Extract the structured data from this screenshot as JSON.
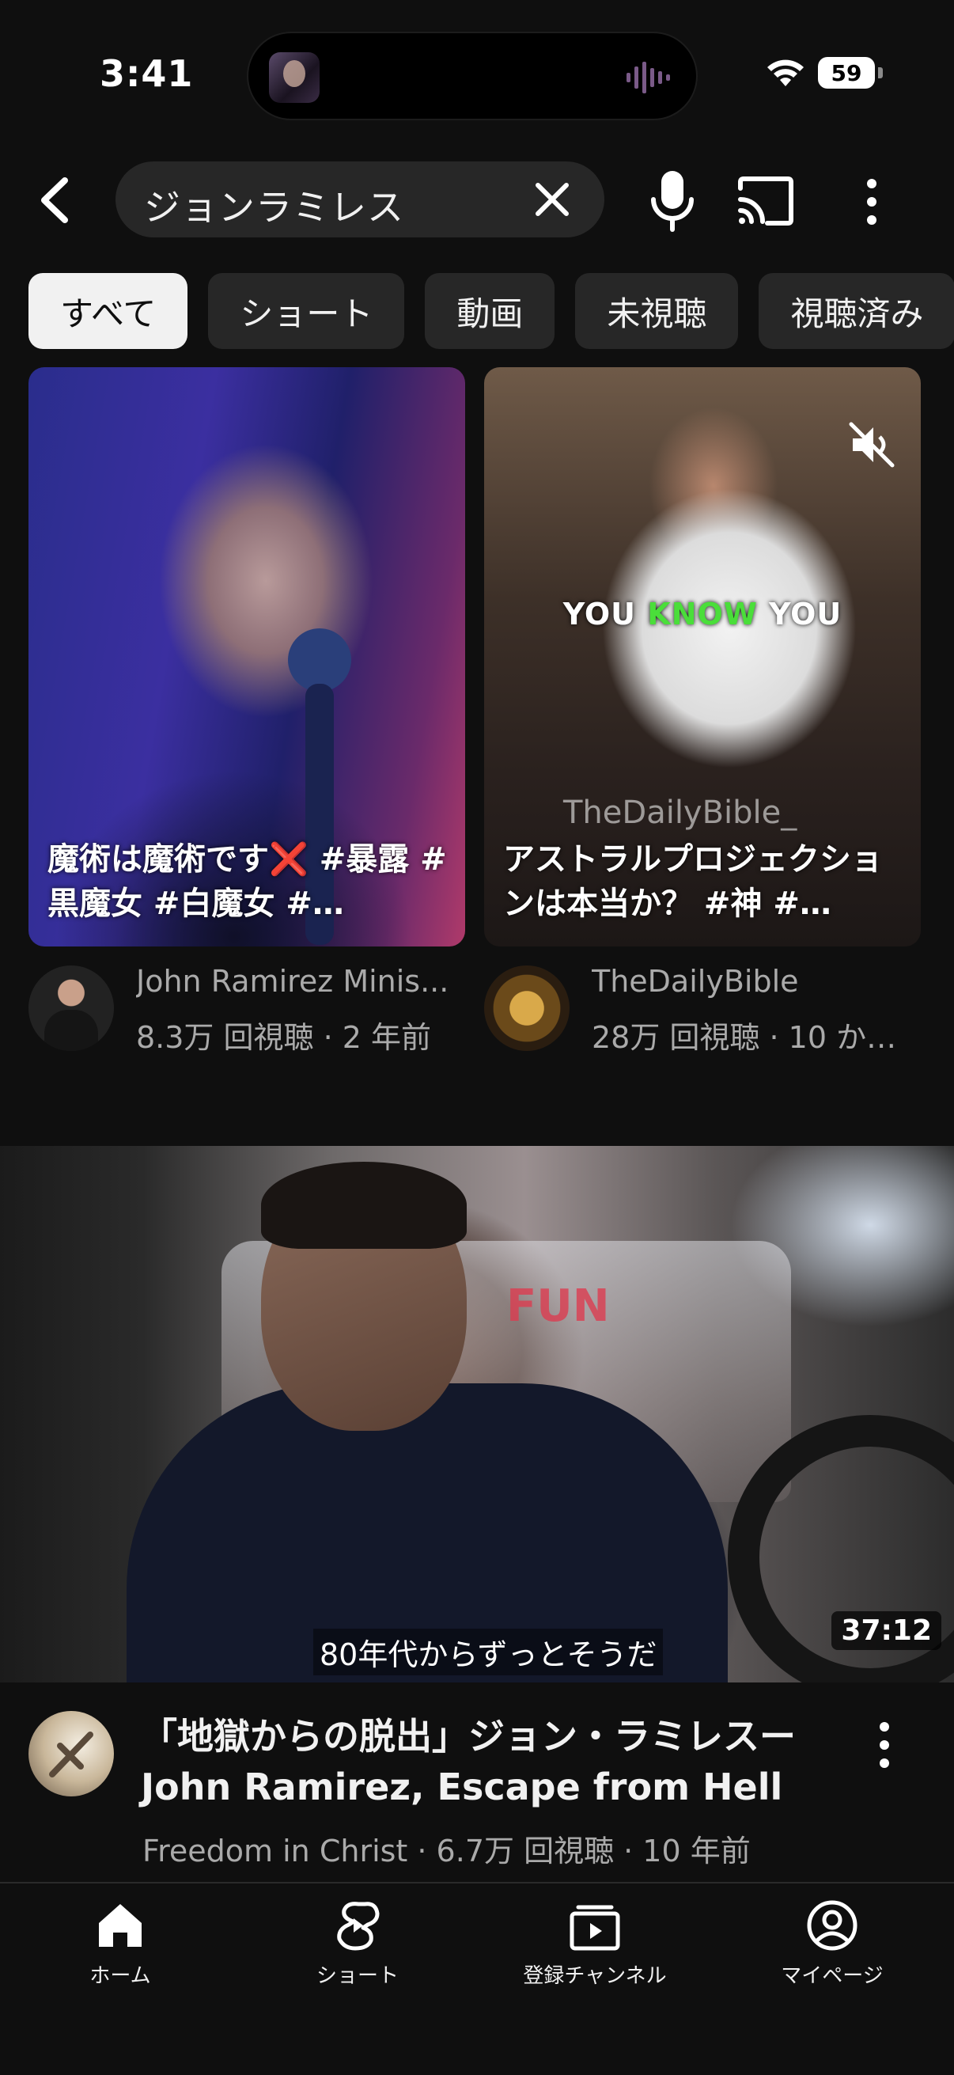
{
  "status_bar": {
    "time": "3:41",
    "battery": "59"
  },
  "search": {
    "query": "ジョンラミレス"
  },
  "chips": [
    {
      "label": "すべて",
      "active": true
    },
    {
      "label": "ショート",
      "active": false
    },
    {
      "label": "動画",
      "active": false
    },
    {
      "label": "未視聴",
      "active": false
    },
    {
      "label": "視聴済み",
      "active": false
    }
  ],
  "shorts": [
    {
      "title": "魔術は魔術です❌ #暴露 #黒魔女 #白魔女 #…",
      "channel": "John Ramirez Minis...",
      "stats": "8.3万 回視聴 · 2 年前"
    },
    {
      "title": "アストラルプロジェクションは本当か？ #神 #…",
      "overlay_caption_1": "YOU",
      "overlay_caption_2": "KNOW",
      "overlay_caption_3": "YOU",
      "watermark": "TheDailyBible_",
      "channel": "TheDailyBible",
      "stats": "28万 回視聴 · 10 か…"
    }
  ],
  "video": {
    "title": "「地獄からの脱出」ジョン・ラミレスーJohn Ramirez, Escape from Hell",
    "channel_stats": "Freedom in Christ · 6.7万 回視聴 · 10 年前",
    "duration": "37:12",
    "subtitle": "80年代からずっとそうだ",
    "sign_text": "FUN"
  },
  "bottom_nav": {
    "home": "ホーム",
    "shorts": "ショート",
    "subscriptions": "登録チャンネル",
    "me": "マイページ"
  },
  "colors": {
    "background": "#0f0f0f",
    "chip_bg": "#272727",
    "chip_active_bg": "#f1f1f1",
    "secondary_text": "#aaaaaa",
    "caption_green": "#4ade3a"
  }
}
